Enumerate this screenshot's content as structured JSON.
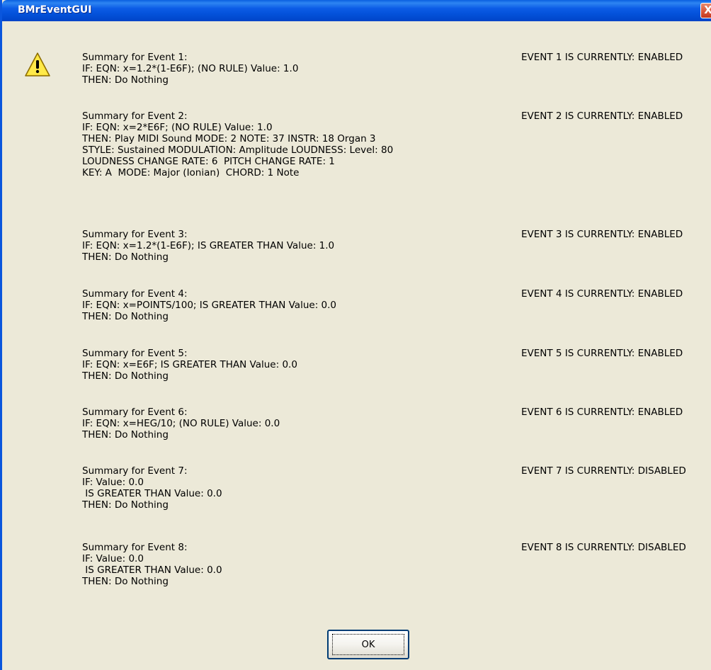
{
  "window": {
    "title": "BMrEventGUI",
    "close_label": "X",
    "icon": "warning-icon"
  },
  "events": [
    {
      "summary": "Summary for Event 1:\nIF: EQN: x=1.2*(1-E6F); (NO RULE) Value: 1.0\nTHEN: Do Nothing",
      "status": "EVENT 1 IS CURRENTLY: ENABLED"
    },
    {
      "summary": "Summary for Event 2:\nIF: EQN: x=2*E6F; (NO RULE) Value: 1.0\nTHEN: Play MIDI Sound MODE: 2 NOTE: 37 INSTR: 18 Organ 3\nSTYLE: Sustained MODULATION: Amplitude LOUDNESS: Level: 80\nLOUDNESS CHANGE RATE: 6  PITCH CHANGE RATE: 1\nKEY: A  MODE: Major (Ionian)  CHORD: 1 Note",
      "status": "EVENT 2 IS CURRENTLY: ENABLED"
    },
    {
      "summary": "Summary for Event 3:\nIF: EQN: x=1.2*(1-E6F); IS GREATER THAN Value: 1.0\nTHEN: Do Nothing",
      "status": "EVENT 3 IS CURRENTLY: ENABLED"
    },
    {
      "summary": "Summary for Event 4:\nIF: EQN: x=POINTS/100; IS GREATER THAN Value: 0.0\nTHEN: Do Nothing",
      "status": "EVENT 4 IS CURRENTLY: ENABLED"
    },
    {
      "summary": "Summary for Event 5:\nIF: EQN: x=E6F; IS GREATER THAN Value: 0.0\nTHEN: Do Nothing",
      "status": "EVENT 5 IS CURRENTLY: ENABLED"
    },
    {
      "summary": "Summary for Event 6:\nIF: EQN: x=HEG/10; (NO RULE) Value: 0.0\nTHEN: Do Nothing",
      "status": "EVENT 6 IS CURRENTLY: ENABLED"
    },
    {
      "summary": "Summary for Event 7:\nIF: Value: 0.0\n IS GREATER THAN Value: 0.0\nTHEN: Do Nothing",
      "status": "EVENT 7 IS CURRENTLY: DISABLED"
    },
    {
      "summary": "Summary for Event 8:\nIF: Value: 0.0\n IS GREATER THAN Value: 0.0\nTHEN: Do Nothing",
      "status": "EVENT 8 IS CURRENTLY: DISABLED"
    }
  ],
  "buttons": {
    "ok_label": "OK"
  }
}
